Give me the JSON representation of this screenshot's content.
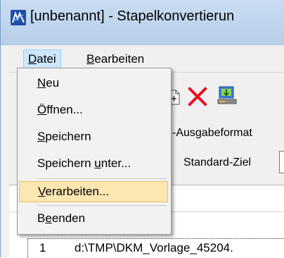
{
  "window": {
    "title": "[unbenannt] - Stapelkonvertierun"
  },
  "menubar": {
    "items": [
      {
        "label_mnemonic": "D",
        "label_rest": "atei"
      },
      {
        "label_mnemonic": "B",
        "label_rest": "earbeiten"
      }
    ]
  },
  "toolbar": {
    "icons": [
      "new-file-icon",
      "delete-x-icon",
      "process-icon"
    ],
    "delete_color": "#e81123"
  },
  "fields": {
    "output_format_label": "-Ausgabeformat",
    "standard_target_label": "Standard-Ziel"
  },
  "dropdown": {
    "items": [
      {
        "pre": "",
        "mnemonic": "N",
        "post": "eu"
      },
      {
        "pre": "",
        "mnemonic": "Ö",
        "post": "ffnen..."
      },
      {
        "pre": "",
        "mnemonic": "S",
        "post": "peichern"
      },
      {
        "pre": "Speichern ",
        "mnemonic": "u",
        "post": "nter..."
      },
      {
        "pre": "",
        "mnemonic": "V",
        "post": "erarbeiten..."
      },
      {
        "pre": "B",
        "mnemonic": "e",
        "post": "enden"
      }
    ],
    "highlighted_index": 4,
    "highlight_color": "#fce6b1"
  },
  "list": {
    "rows": [
      {
        "num": "1",
        "path": "d:\\TMP\\DKM_Vorlage_45204."
      }
    ]
  }
}
